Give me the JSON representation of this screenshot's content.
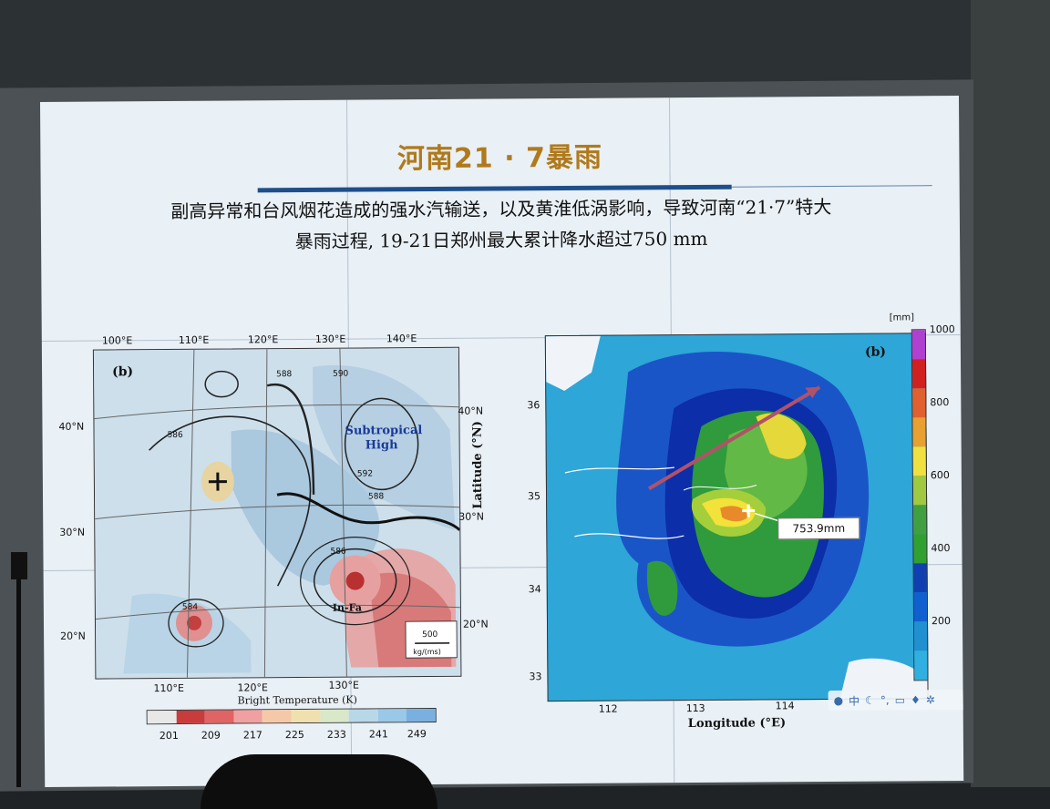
{
  "slide": {
    "title": "河南21 · 7暴雨",
    "subtitle_line1": "副高异常和台风烟花造成的强水汽输送，以及黄淮低涡影响，导致河南“21·7”特大",
    "subtitle_line2": "暴雨过程, 19-21日郑州最大累计降水超过750 mm"
  },
  "left_panel": {
    "panel_letter": "(b)",
    "top_lon_ticks": [
      "100°E",
      "110°E",
      "120°E",
      "130°E",
      "140°E"
    ],
    "bottom_lon_ticks": [
      "110°E",
      "120°E",
      "130°E"
    ],
    "left_lat_ticks": [
      "40°N",
      "30°N",
      "20°N"
    ],
    "right_lat_ticks": [
      "40°N",
      "30°N",
      "20°N"
    ],
    "contour_labels": [
      "586",
      "588",
      "590",
      "592",
      "584",
      "586",
      "588"
    ],
    "subtropical_high": "Subtropical\nHigh",
    "typhoon_name": "In-Fa",
    "vector_ref_value": "500",
    "vector_ref_unit": "kg/(ms)",
    "colorbar_title": "Bright Temperature (K)",
    "colorbar_ticks": [
      "201",
      "209",
      "217",
      "225",
      "233",
      "241",
      "249"
    ],
    "colorbar_colors": [
      "#e8e8e8",
      "#c83c3c",
      "#e06464",
      "#f0a0a0",
      "#f5c9a8",
      "#f0e0b0",
      "#d8e8c8",
      "#b8d8e8",
      "#9ac8e8",
      "#7ab0e0"
    ]
  },
  "right_panel": {
    "panel_letter": "(b)",
    "unit_label": "[mm]",
    "lat_ticks": [
      "36",
      "35",
      "34",
      "33"
    ],
    "lon_ticks": [
      "112",
      "113",
      "114"
    ],
    "y_axis_label": "Latitude (°N)",
    "x_axis_label": "Longitude (°E)",
    "callout_value": "753.9mm",
    "colorbar_ticks": [
      "1000",
      "800",
      "600",
      "400",
      "200"
    ],
    "colorbar_colors": [
      "#b040d0",
      "#d02020",
      "#e06030",
      "#e8a030",
      "#f0e040",
      "#a0c840",
      "#40a040",
      "#30a030",
      "#1040b0",
      "#1060d0",
      "#2090d0",
      "#30b0e0"
    ]
  },
  "toolbar_icons": [
    "globe-icon",
    "input-mode-icon",
    "moon-icon",
    "punctuation-icon",
    "keyboard-icon",
    "mic-icon",
    "settings-icon"
  ]
}
